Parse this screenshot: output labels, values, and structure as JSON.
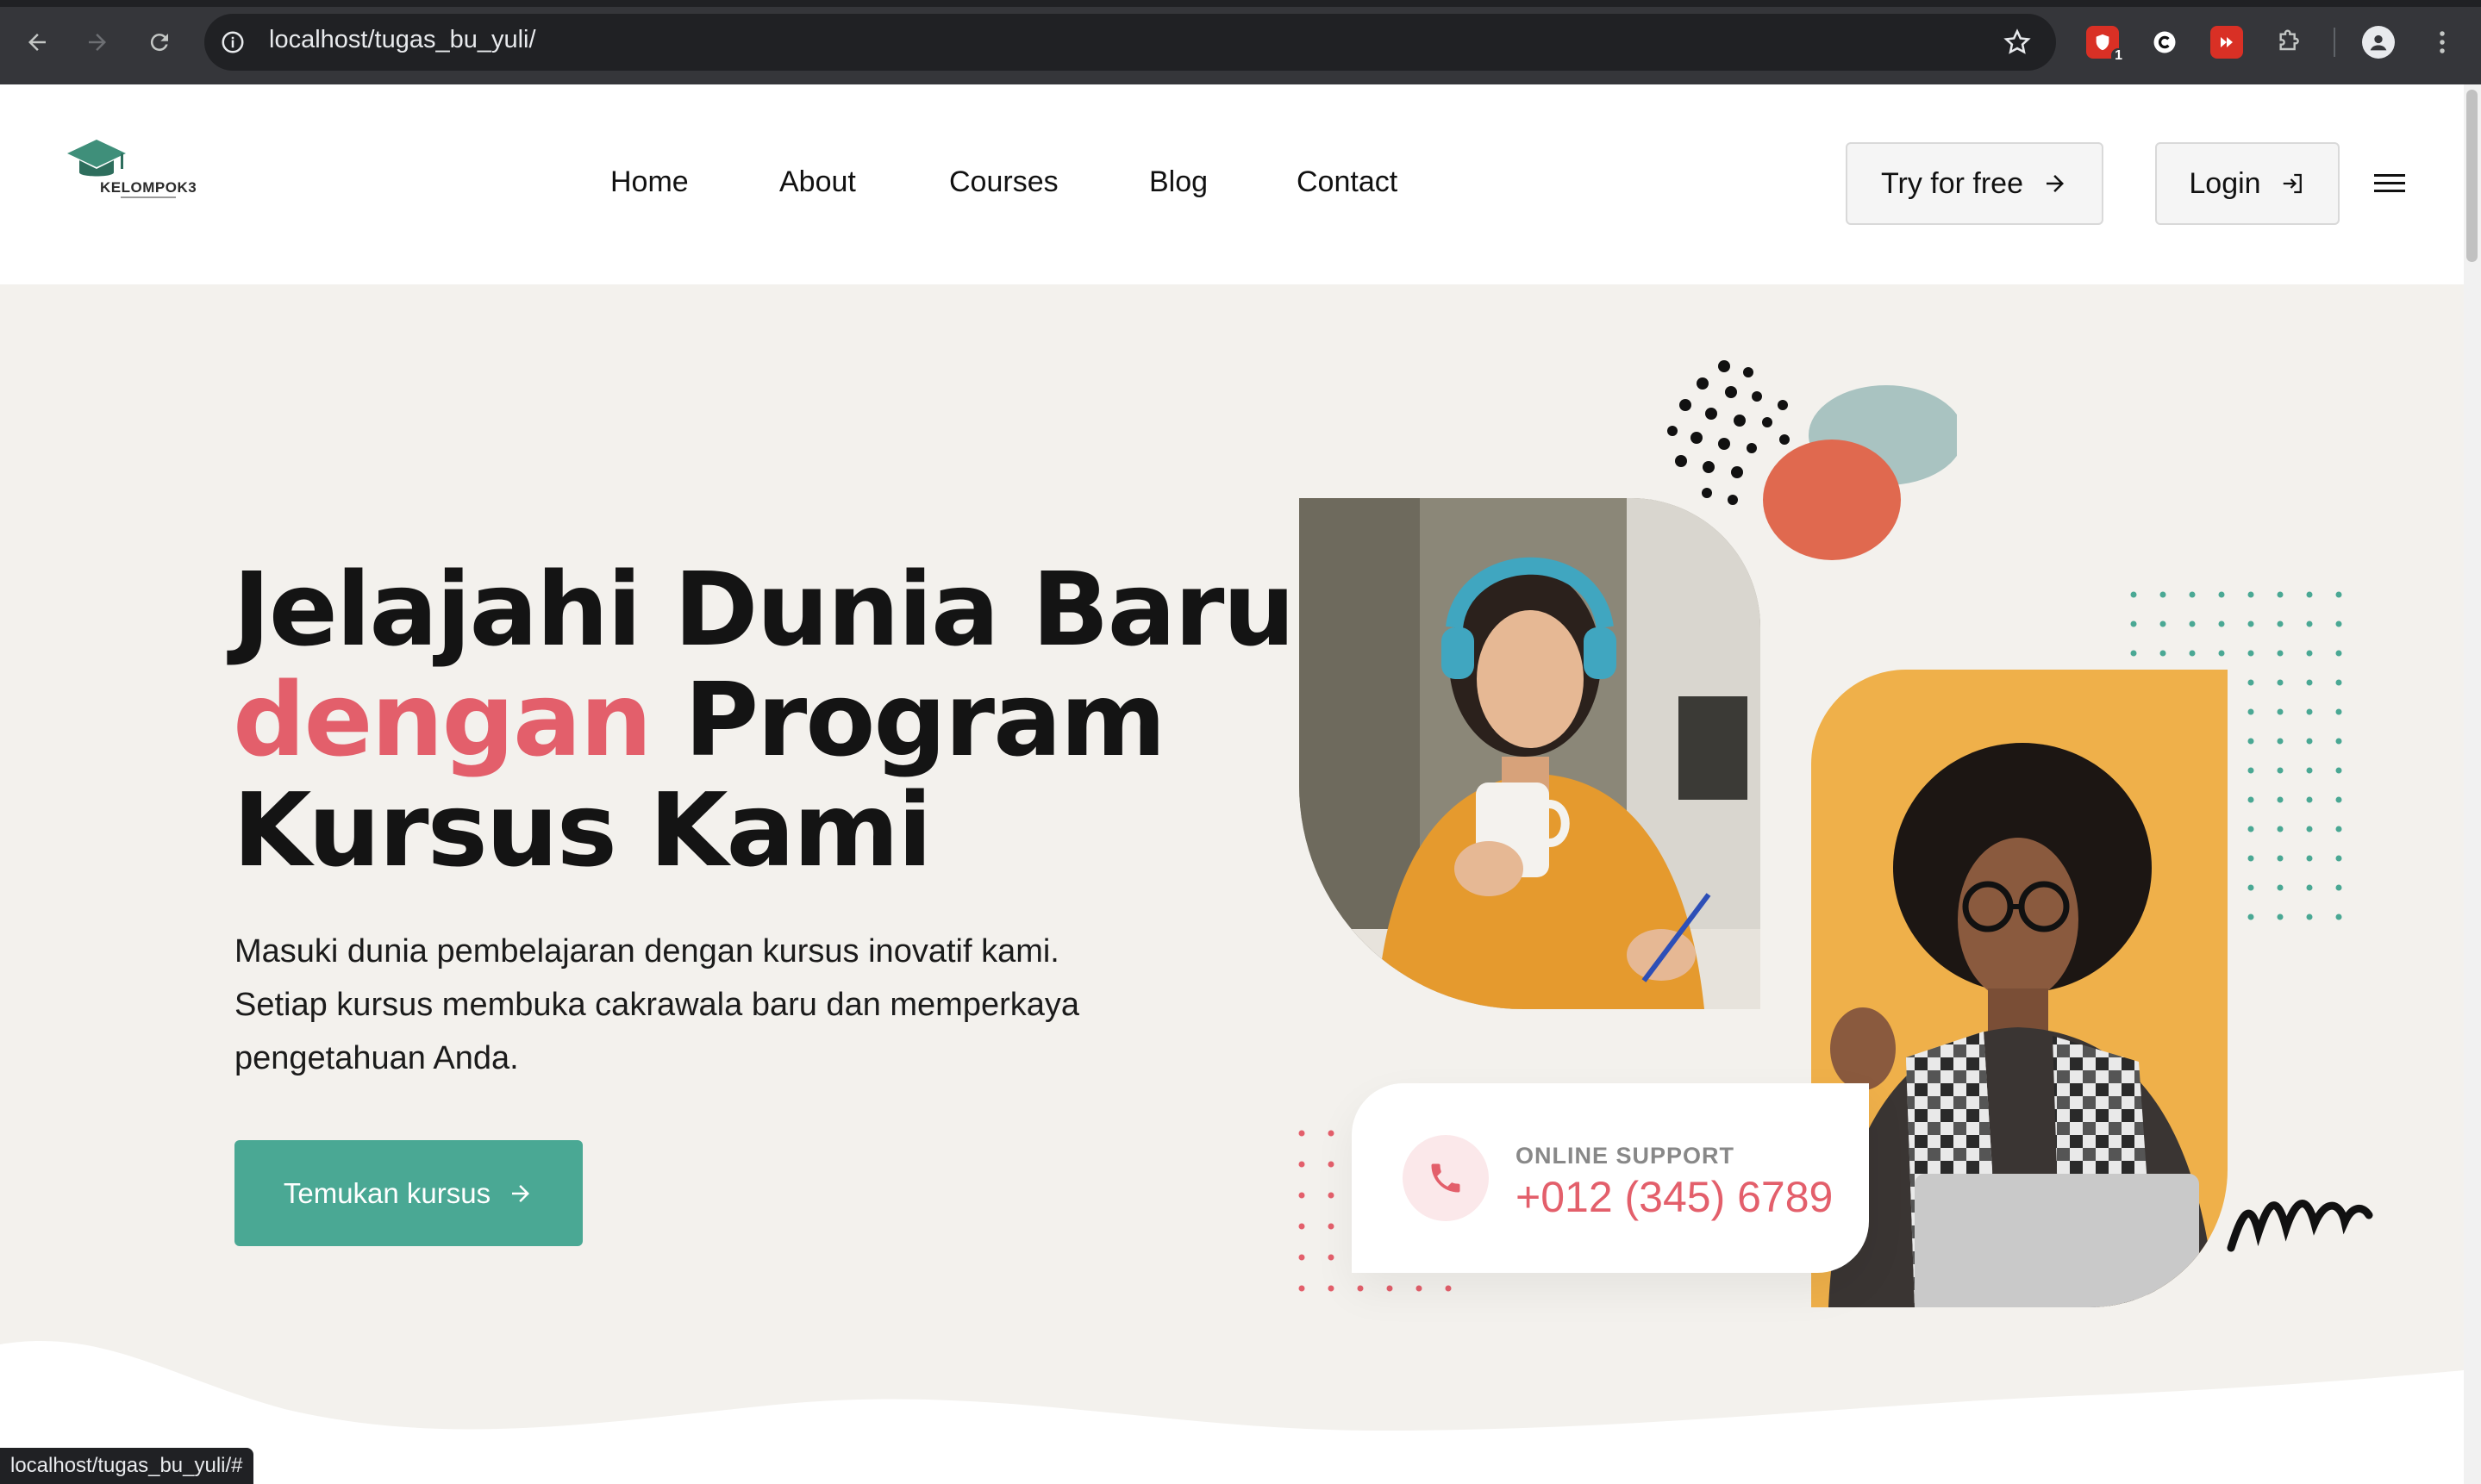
{
  "browser": {
    "url": "localhost/tugas_bu_yuli/",
    "status_url": "localhost/tugas_bu_yuli/#",
    "ext_badge": "1"
  },
  "site": {
    "logo_text": "KELOMPOK3",
    "nav": [
      "Home",
      "About",
      "Courses",
      "Blog",
      "Contact"
    ],
    "try_label": "Try for free",
    "login_label": "Login"
  },
  "hero": {
    "line1": "Jelajahi Dunia Baru",
    "highlight": "dengan",
    "line2_rest": " Program",
    "line3": "Kursus Kami",
    "para": [
      "Masuki dunia pembelajaran dengan kursus inovatif kami.",
      "Setiap kursus membuka cakrawala baru dan memperkaya",
      "pengetahuan Anda."
    ],
    "cta_label": "Temukan kursus"
  },
  "support": {
    "label": "ONLINE SUPPORT",
    "phone": "+012 (345) 6789"
  },
  "colors": {
    "accent": "#4aa894",
    "highlight": "#e35f6b",
    "hero_bg": "#f3f1ed",
    "photo_bg_1": "#e8a13c",
    "photo_bg_2": "#efb04a"
  }
}
